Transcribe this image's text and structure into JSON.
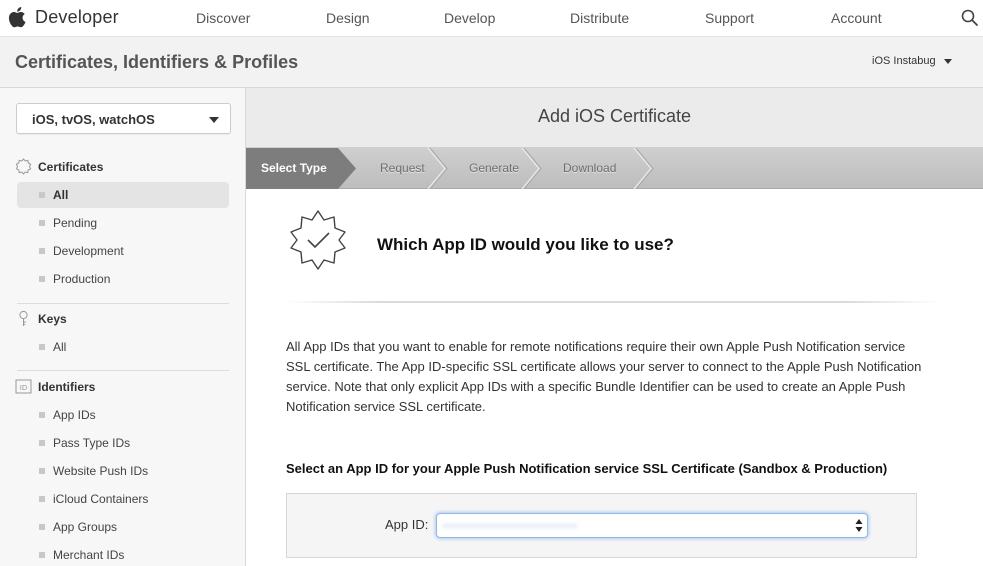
{
  "topnav": {
    "brand": "Developer",
    "links": [
      "Discover",
      "Design",
      "Develop",
      "Distribute",
      "Support",
      "Account"
    ]
  },
  "subheader": {
    "title": "Certificates, Identifiers & Profiles",
    "team": "iOS Instabug"
  },
  "sidebar": {
    "platform": "iOS, tvOS, watchOS",
    "sections": [
      {
        "title": "Certificates",
        "icon": "certificate-icon",
        "items": [
          "All",
          "Pending",
          "Development",
          "Production"
        ],
        "active": "All"
      },
      {
        "title": "Keys",
        "icon": "key-icon",
        "items": [
          "All"
        ]
      },
      {
        "title": "Identifiers",
        "icon": "id-icon",
        "items": [
          "App IDs",
          "Pass Type IDs",
          "Website Push IDs",
          "iCloud Containers",
          "App Groups",
          "Merchant IDs"
        ]
      }
    ]
  },
  "main": {
    "title": "Add iOS Certificate",
    "steps": [
      "Select Type",
      "Request",
      "Generate",
      "Download"
    ],
    "active_step": "Select Type",
    "question": "Which App ID would you like to use?",
    "description": "All App IDs that you want to enable for remote notifications require their own Apple Push Notification service SSL certificate. The App ID-specific SSL certificate allows your server to connect to the Apple Push Notification service. Note that only explicit App IDs with a specific Bundle Identifier can be used to create an Apple Push Notification service SSL certificate.",
    "select_heading": "Select an App ID for your Apple Push Notification service SSL Certificate (Sandbox & Production)",
    "appid_label": "App ID:",
    "appid_value": "••••••••••••••••••••••••••"
  },
  "colors": {
    "active_step_bg": "#7d7d7d",
    "focus_ring": "#8fb7e9"
  }
}
